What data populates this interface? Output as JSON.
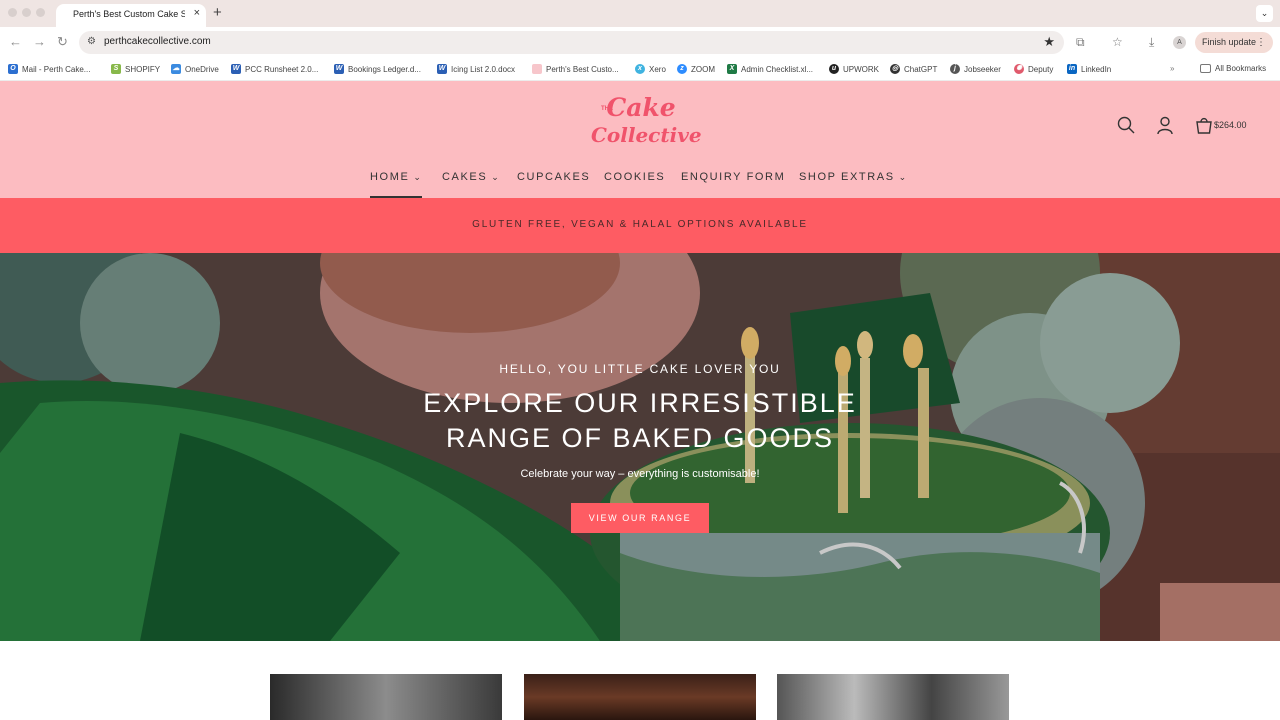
{
  "browser": {
    "tab_title": "Perth's Best Custom Cake Sh",
    "tab_close": "×",
    "new_tab": "+",
    "url": "perthcakecollective.com",
    "finish_update": "Finish update",
    "profile_initial": "A",
    "bookmarks": [
      {
        "label": "Mail - Perth Cake...",
        "icon": "outlook-icon",
        "color": "#2c6fd0"
      },
      {
        "label": "SHOPIFY",
        "icon": "shopify-icon",
        "color": "#88b84a"
      },
      {
        "label": "OneDrive",
        "icon": "onedrive-icon",
        "color": "#3b8be0"
      },
      {
        "label": "PCC Runsheet 2.0...",
        "icon": "word-icon",
        "color": "#2b5fb4"
      },
      {
        "label": "Bookings Ledger.d...",
        "icon": "word-icon",
        "color": "#2b5fb4"
      },
      {
        "label": "Icing List 2.0.docx",
        "icon": "word-icon",
        "color": "#2b5fb4"
      },
      {
        "label": "Perth's Best Custo...",
        "icon": "site-icon",
        "color": "#f7c6cb"
      },
      {
        "label": "Xero",
        "icon": "xero-icon",
        "color": "#3fb3e0"
      },
      {
        "label": "ZOOM",
        "icon": "zoom-icon",
        "color": "#2d8cff"
      },
      {
        "label": "Admin Checklist.xl...",
        "icon": "excel-icon",
        "color": "#1f7a45"
      },
      {
        "label": "UPWORK",
        "icon": "upwork-icon",
        "color": "#222222"
      },
      {
        "label": "ChatGPT",
        "icon": "chatgpt-icon",
        "color": "#333333"
      },
      {
        "label": "Jobseeker",
        "icon": "jobseeker-icon",
        "color": "#555555"
      },
      {
        "label": "Deputy",
        "icon": "deputy-icon",
        "color": "#e05a6c"
      },
      {
        "label": "LinkedIn",
        "icon": "linkedin-icon",
        "color": "#0a66c2"
      }
    ],
    "all_bookmarks": "All Bookmarks"
  },
  "site": {
    "logo_line1": "Cake",
    "logo_line2": "Collective",
    "logo_prefix": "THE",
    "cart_total": "$264.00",
    "nav": [
      {
        "label": "HOME",
        "has_menu": true
      },
      {
        "label": "CAKES",
        "has_menu": true
      },
      {
        "label": "CUPCAKES",
        "has_menu": false
      },
      {
        "label": "COOKIES",
        "has_menu": false
      },
      {
        "label": "ENQUIRY FORM",
        "has_menu": false
      },
      {
        "label": "SHOP EXTRAS",
        "has_menu": true
      }
    ],
    "chevron": "⌄",
    "announcement": "GLUTEN FREE, VEGAN & HALAL OPTIONS AVAILABLE",
    "hero": {
      "eyebrow": "HELLO, YOU LITTLE CAKE LOVER YOU",
      "title_line1": "EXPLORE OUR IRRESISTIBLE",
      "title_line2": "RANGE OF BAKED GOODS",
      "subtitle": "Celebrate your way – everything is customisable!",
      "cta": "VIEW OUR RANGE"
    }
  },
  "colors": {
    "header_bg": "#fcbcc1",
    "accent": "#fe5c63",
    "logo": "#f0536b"
  }
}
